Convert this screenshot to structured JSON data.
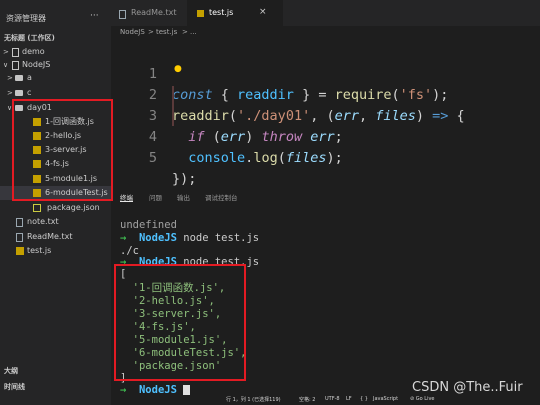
{
  "sidebar": {
    "title": "资源管理器",
    "more": "···",
    "workspace": "无标题 (工作区)",
    "tree": [
      {
        "label": "demo",
        "chevron": ">",
        "icon": "workspace-folder-icon"
      },
      {
        "label": "NodeJS",
        "chevron": "∨",
        "icon": "workspace-folder-icon"
      },
      {
        "label": "a",
        "chevron": ">",
        "icon": "folder-icon"
      },
      {
        "label": "c",
        "chevron": ">",
        "icon": "folder-icon"
      },
      {
        "label": "day01",
        "chevron": "∨",
        "icon": "folder-icon"
      },
      {
        "label": "1-回调函数.js",
        "icon": "js-file-icon"
      },
      {
        "label": "2-hello.js",
        "icon": "js-file-icon"
      },
      {
        "label": "3-server.js",
        "icon": "js-file-icon"
      },
      {
        "label": "4-fs.js",
        "icon": "js-file-icon"
      },
      {
        "label": "5-module1.js",
        "icon": "js-file-icon"
      },
      {
        "label": "6-moduleTest.js",
        "icon": "js-file-icon"
      },
      {
        "label": "package.json",
        "icon": "json-file-icon"
      },
      {
        "label": "note.txt",
        "icon": "text-file-icon"
      },
      {
        "label": "ReadMe.txt",
        "icon": "text-file-icon"
      },
      {
        "label": "test.js",
        "icon": "js-file-icon"
      }
    ],
    "outline": "大纲",
    "timeline": "时间线"
  },
  "tabs": [
    {
      "label": "ReadMe.txt",
      "icon": "text-file-icon"
    },
    {
      "label": "test.js",
      "icon": "js-file-icon",
      "close": "×"
    }
  ],
  "breadcrumb": [
    "NodeJS",
    ">",
    "test.js",
    ">",
    "..."
  ],
  "code": {
    "line_numbers": [
      "1",
      "2",
      "3",
      "4",
      "5"
    ]
  },
  "panel_tabs": [
    "终端",
    "问题",
    "输出",
    "调试控制台"
  ],
  "terminal": {
    "undefined_line": "undefined",
    "prompt_arrow": "→",
    "prompt_dir": "NodeJS",
    "command": "node test.js",
    "error_line": "./c",
    "array_open": "[",
    "files": [
      "'1-回调函数.js',",
      "'2-hello.js',",
      "'3-server.js',",
      "'4-fs.js',",
      "'5-module1.js',",
      "'6-moduleTest.js',",
      "'package.json'"
    ],
    "array_close": "]"
  },
  "watermark": "CSDN @The..Fuir",
  "statusbar": {
    "position": "行 1，列 1 (已选择119)",
    "spaces": "空格: 2",
    "encoding": "UTF-8",
    "eol": "LF",
    "language_bracket": "{ }",
    "language": "JavaScript",
    "golive": "⊘ Go Live"
  },
  "colors": {
    "highlight_box": "#e31b23",
    "editor_bg": "#1e1e1e",
    "sidebar_bg": "#252526"
  }
}
